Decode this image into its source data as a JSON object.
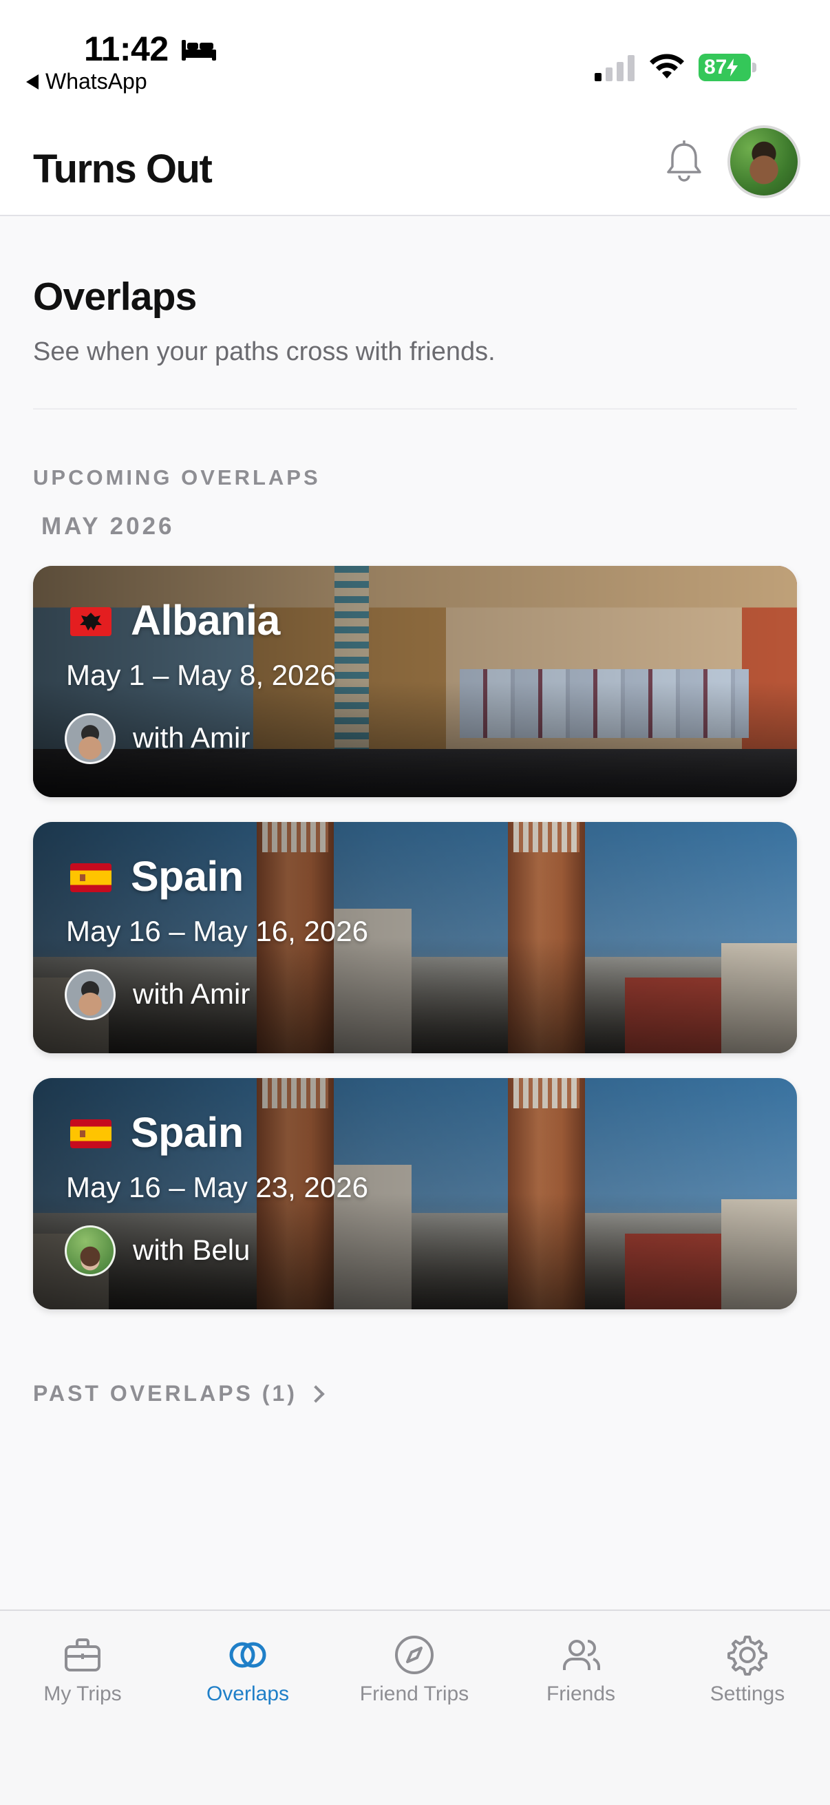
{
  "status": {
    "time": "11:42",
    "back_app": "WhatsApp",
    "battery": "87"
  },
  "header": {
    "title": "Turns Out"
  },
  "main": {
    "heading": "Overlaps",
    "subtitle": "See when your paths cross with friends.",
    "upcoming_label": "UPCOMING OVERLAPS",
    "month_label": "MAY 2026",
    "cards": [
      {
        "country": "Albania",
        "dates": "May 1 – May 8, 2026",
        "with": "with Amir",
        "flag": "albania-flag-icon",
        "image": "albania-street"
      },
      {
        "country": "Spain",
        "dates": "May 16 – May 16, 2026",
        "with": "with Amir",
        "flag": "spain-flag-icon",
        "image": "barcelona-towers"
      },
      {
        "country": "Spain",
        "dates": "May 16 – May 23, 2026",
        "with": "with Belu",
        "flag": "spain-flag-icon",
        "image": "barcelona-towers"
      }
    ],
    "past_label": "PAST OVERLAPS (1)"
  },
  "tabs": [
    {
      "label": "My Trips",
      "icon": "briefcase-icon",
      "active": false
    },
    {
      "label": "Overlaps",
      "icon": "overlap-rings-icon",
      "active": true
    },
    {
      "label": "Friend Trips",
      "icon": "compass-icon",
      "active": false
    },
    {
      "label": "Friends",
      "icon": "people-icon",
      "active": false
    },
    {
      "label": "Settings",
      "icon": "gear-icon",
      "active": false
    }
  ],
  "colors": {
    "accent": "#1f7fc8",
    "battery": "#34c759",
    "muted": "#8e8e93"
  }
}
